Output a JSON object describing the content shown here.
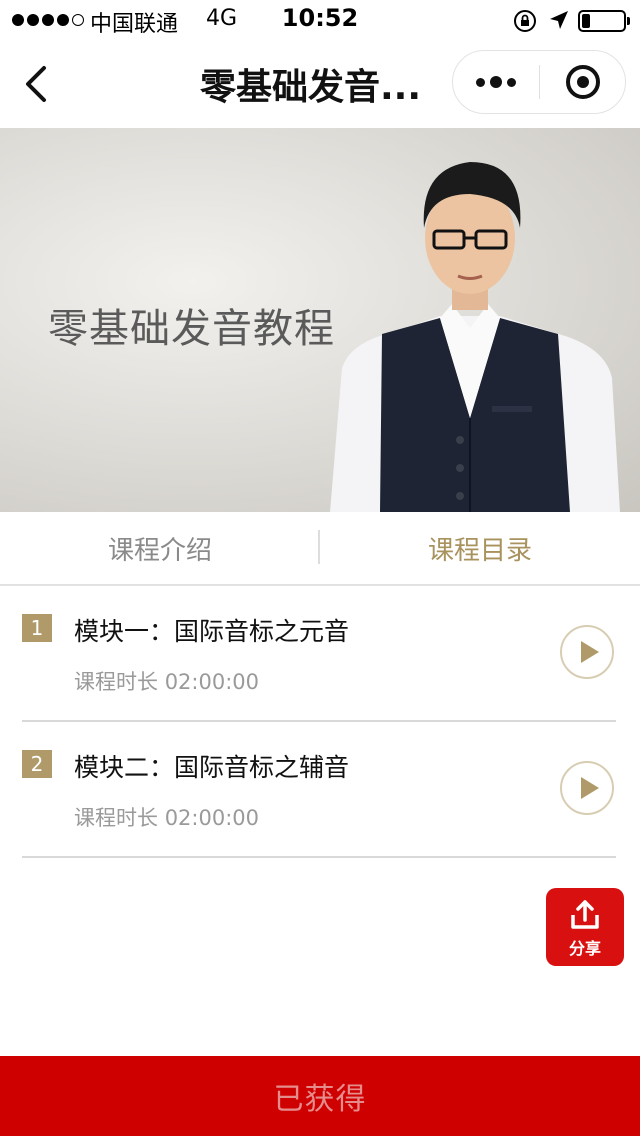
{
  "status_bar": {
    "carrier": "中国联通",
    "network": "4G",
    "time": "10:52",
    "signal_bars_filled": 4,
    "signal_bars_total": 5,
    "icons": [
      "orientation-lock-icon",
      "location-arrow-icon",
      "battery-icon"
    ],
    "battery_level": 0.15
  },
  "nav": {
    "title": "零基础发音...",
    "back_icon": "chevron-left-icon",
    "more_icon": "more-dots-icon",
    "close_icon": "target-close-icon"
  },
  "banner": {
    "title": "零基础发音教程"
  },
  "tabs": [
    {
      "label": "课程介绍",
      "active": false
    },
    {
      "label": "课程目录",
      "active": true
    }
  ],
  "modules": [
    {
      "index": "1",
      "title": "模块一：国际音标之元音",
      "duration_label": "课程时长",
      "duration": "02:00:00"
    },
    {
      "index": "2",
      "title": "模块二：国际音标之辅音",
      "duration_label": "课程时长",
      "duration": "02:00:00"
    }
  ],
  "share": {
    "label": "分享",
    "icon": "share-upload-icon"
  },
  "bottom_button": {
    "label": "已获得"
  },
  "colors": {
    "accent_gold": "#b09a6a",
    "primary_red": "#cf0000",
    "share_red": "#d81010"
  }
}
